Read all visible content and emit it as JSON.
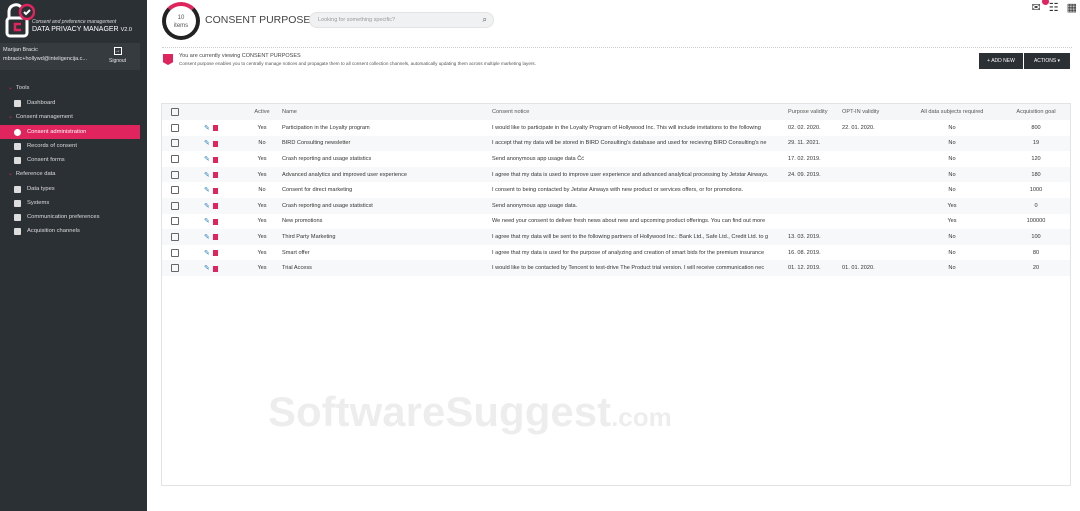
{
  "app": {
    "subtitle": "Consent and preference management",
    "name": "DATA PRIVACY MANAGER",
    "version": "V2.0"
  },
  "user": {
    "name": "Marijan Bracic",
    "email": "mbracic+hollywd@inteligencija.c...",
    "signout": "Signout"
  },
  "nav": [
    {
      "section": "Tools",
      "items": [
        {
          "label": "Dashboard",
          "icon": "dashboard-icon"
        }
      ]
    },
    {
      "section": "Consent management",
      "items": [
        {
          "label": "Consent administration",
          "icon": "shield-icon",
          "active": true
        },
        {
          "label": "Records of consent",
          "icon": "check-circle-icon"
        },
        {
          "label": "Consent forms",
          "icon": "document-icon"
        }
      ]
    },
    {
      "section": "Reference data",
      "items": [
        {
          "label": "Data types",
          "icon": "warning-icon"
        },
        {
          "label": "Systems",
          "icon": "systems-icon"
        },
        {
          "label": "Communication preferences",
          "icon": "preferences-icon"
        },
        {
          "label": "Acquisition channels",
          "icon": "truck-icon"
        }
      ]
    }
  ],
  "header": {
    "count": "10",
    "count_label": "items",
    "title": "CONSENT PURPOSES",
    "search_placeholder": "Looking for something specific?"
  },
  "info": {
    "line1": "You are currently viewing CONSENT PURPOSES",
    "line2": "Consent purpose enables you to centrally manage notices and propagate them to all consent collection channels, automatically updating them across multiple marketing layers."
  },
  "buttons": {
    "add": "+ ADD NEW",
    "actions": "ACTIONS ▾"
  },
  "table": {
    "columns": [
      "Active",
      "Name",
      "Consent notice",
      "Purpose validity",
      "OPT-IN validity",
      "All data subjects required",
      "Acquisition goal"
    ],
    "rows": [
      [
        "Yes",
        "Participation in the Loyalty program",
        "I would like to participate in the Loyalty Program of Hollywood Inc. This will include invitations to the following",
        "02. 02. 2020.",
        "22. 01. 2020.",
        "No",
        "800"
      ],
      [
        "No",
        "BIRD Consulting newsletter",
        "I accept that my data will be stored in BIRD Consulting's  database and used for recieving BIRD Consulting's ne",
        "29. 11. 2021.",
        "",
        "No",
        "19"
      ],
      [
        "Yes",
        "Crash reporting and usage statistics",
        "Send anonymous app usage data Čć",
        "17. 02. 2019.",
        "",
        "No",
        "120"
      ],
      [
        "Yes",
        "Advanced analytics and improved user experience",
        "I agree that my data is used to improve user experience and advanced analytical processing by Jetstar Airways.",
        "24. 09. 2019.",
        "",
        "No",
        "180"
      ],
      [
        "No",
        "Consent for direct marketing",
        "I consent to being contacted by Jetstar Airways with new product or services offers, or for promotions.",
        "",
        "",
        "No",
        "1000"
      ],
      [
        "Yes",
        "Crash reporting and usage statisticst",
        "Send anonymous app usage data.",
        "",
        "",
        "Yes",
        "0"
      ],
      [
        "Yes",
        "New promotions",
        "We need your consent to deliver fresh news about new and upcoming product offerings. You can find out more",
        "",
        "",
        "Yes",
        "100000"
      ],
      [
        "Yes",
        "Third Party Marketing",
        "I agree that my data will be sent to the following partners of Hollywood Inc.: Bank Ltd., Safe Ltd., Credit Ltd. to g",
        "13. 03. 2019.",
        "",
        "No",
        "100"
      ],
      [
        "Yes",
        "Smart offer",
        "I agree that my data is used for the purpose of analyzing and creation of smart bids for the premium insurance",
        "16. 08. 2019.",
        "",
        "No",
        "80"
      ],
      [
        "Yes",
        "Trial Access",
        "I would like to be contacted by Tencent to test-drive The Product trial version. I will receive communication nec",
        "01. 12. 2019.",
        "01. 01. 2020.",
        "No",
        "20"
      ]
    ]
  },
  "watermark": {
    "main": "SoftwareSuggest",
    "tld": ".com"
  },
  "colors": {
    "accent": "#e0245e",
    "sidebar": "#2b3035"
  }
}
